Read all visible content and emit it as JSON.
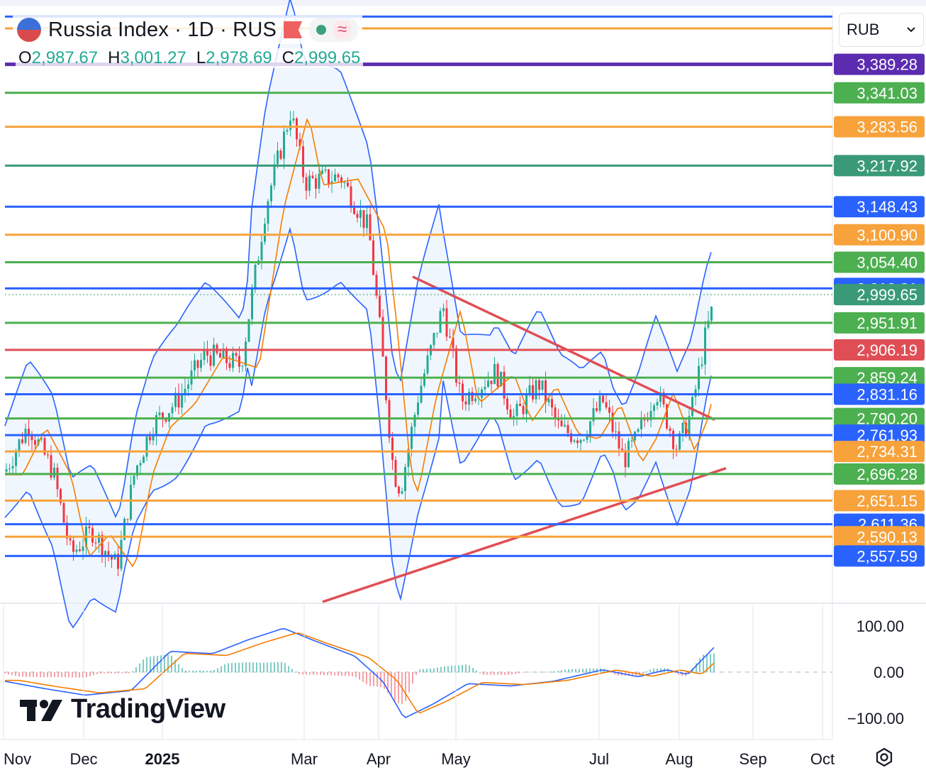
{
  "header": {
    "title": "Russia Index · 1D · RUS",
    "wave_symbol": "≈",
    "ohlc": [
      {
        "key": "O",
        "value": "2,987.67"
      },
      {
        "key": "H",
        "value": "3,001.27"
      },
      {
        "key": "L",
        "value": "2,978.69"
      },
      {
        "key": "C",
        "value": "2,999.65"
      }
    ]
  },
  "currency": {
    "selected": "RUB",
    "chevron_icon": "chevron-down-icon"
  },
  "branding": {
    "logo_text": "TradingView",
    "settings_icon": "gear-icon"
  },
  "colors": {
    "up": "#22ab94",
    "down": "#f23645",
    "band": "#2962ff",
    "ma": "#f57c00",
    "trend": "#e04e55",
    "purple": "#5b2cb0",
    "green": "#4caf50",
    "orange": "#f7a23b",
    "blue": "#2962ff",
    "red": "#e04e55"
  },
  "chart_data": {
    "type": "candlestick",
    "y_range": [
      2480,
      3480
    ],
    "x_axis": [
      "Nov",
      "Dec",
      "2025",
      "Mar",
      "Apr",
      "May",
      "Jul",
      "Aug",
      "Sep",
      "Oct"
    ],
    "price_levels": [
      {
        "value": 3389.28,
        "label": "3,389.28",
        "color": "purple"
      },
      {
        "value": 3341.03,
        "label": "3,341.03",
        "color": "green"
      },
      {
        "value": 3283.56,
        "label": "3,283.56",
        "color": "orange"
      },
      {
        "value": 3217.92,
        "label": "3,217.92",
        "color": "teal"
      },
      {
        "value": 3148.43,
        "label": "3,148.43",
        "color": "blue"
      },
      {
        "value": 3100.9,
        "label": "3,100.90",
        "color": "orange"
      },
      {
        "value": 3054.4,
        "label": "3,054.40",
        "color": "green"
      },
      {
        "value": 3010.21,
        "label": "3,010.21",
        "color": "blue"
      },
      {
        "value": 2999.65,
        "label": "2,999.65",
        "color": "teal"
      },
      {
        "value": 2951.91,
        "label": "2,951.91",
        "color": "green"
      },
      {
        "value": 2906.19,
        "label": "2,906.19",
        "color": "red"
      },
      {
        "value": 2859.24,
        "label": "2,859.24",
        "color": "green"
      },
      {
        "value": 2831.16,
        "label": "2,831.16",
        "color": "blue"
      },
      {
        "value": 2790.2,
        "label": "2,790.20",
        "color": "green"
      },
      {
        "value": 2761.93,
        "label": "2,761.93",
        "color": "blue"
      },
      {
        "value": 2734.31,
        "label": "2,734.31",
        "color": "orange"
      },
      {
        "value": 2696.28,
        "label": "2,696.28",
        "color": "green"
      },
      {
        "value": 2651.15,
        "label": "2,651.15",
        "color": "orange"
      },
      {
        "value": 2611.36,
        "label": "2,611.36",
        "color": "blue"
      },
      {
        "value": 2590.13,
        "label": "2,590.13",
        "color": "orange"
      },
      {
        "value": 2557.59,
        "label": "2,557.59",
        "color": "blue"
      }
    ],
    "extra_lines": [
      {
        "value": 3470,
        "color": "blue"
      },
      {
        "value": 3450,
        "color": "orange"
      }
    ],
    "oscillator": {
      "type": "macd",
      "ticks": [
        "100.00",
        "0.00",
        "−100.00"
      ],
      "range": [
        -120,
        120
      ]
    }
  }
}
